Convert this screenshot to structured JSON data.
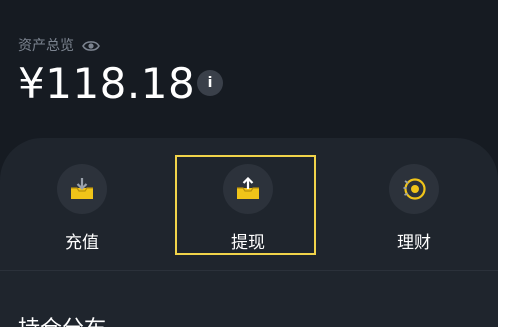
{
  "summary": {
    "title": "资产总览",
    "amount": "¥118.18",
    "info_glyph": "i"
  },
  "actions": [
    {
      "label": "充值",
      "icon": "deposit-icon"
    },
    {
      "label": "提现",
      "icon": "withdraw-icon"
    },
    {
      "label": "理财",
      "icon": "finance-icon"
    }
  ],
  "section": {
    "title": "持仓分布"
  },
  "colors": {
    "background": "#161b22",
    "panel": "#1f252d",
    "accent_yellow": "#f0d34a"
  }
}
